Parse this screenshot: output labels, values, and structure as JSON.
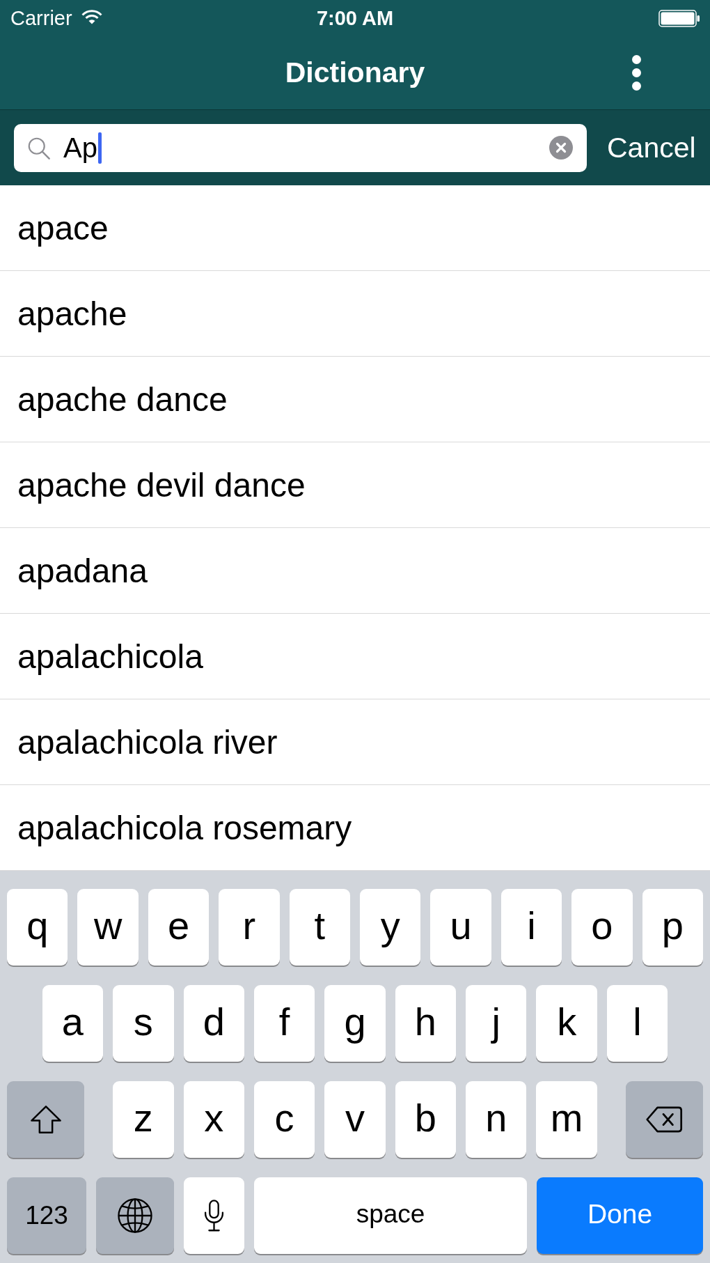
{
  "status_bar": {
    "carrier": "Carrier",
    "time": "7:00 AM"
  },
  "nav_bar": {
    "title": "Dictionary"
  },
  "search": {
    "value": "Ap",
    "cancel": "Cancel"
  },
  "results": [
    "apace",
    "apache",
    "apache dance",
    "apache devil dance",
    "apadana",
    "apalachicola",
    "apalachicola river",
    "apalachicola rosemary"
  ],
  "keyboard": {
    "rows": [
      {
        "keys": [
          {
            "kind": "letter",
            "label": "q"
          },
          {
            "kind": "letter",
            "label": "w"
          },
          {
            "kind": "letter",
            "label": "e"
          },
          {
            "kind": "letter",
            "label": "r"
          },
          {
            "kind": "letter",
            "label": "t"
          },
          {
            "kind": "letter",
            "label": "y"
          },
          {
            "kind": "letter",
            "label": "u"
          },
          {
            "kind": "letter",
            "label": "i"
          },
          {
            "kind": "letter",
            "label": "o"
          },
          {
            "kind": "letter",
            "label": "p"
          }
        ]
      },
      {
        "keys": [
          {
            "kind": "letter",
            "label": "a"
          },
          {
            "kind": "letter",
            "label": "s"
          },
          {
            "kind": "letter",
            "label": "d"
          },
          {
            "kind": "letter",
            "label": "f"
          },
          {
            "kind": "letter",
            "label": "g"
          },
          {
            "kind": "letter",
            "label": "h"
          },
          {
            "kind": "letter",
            "label": "j"
          },
          {
            "kind": "letter",
            "label": "k"
          },
          {
            "kind": "letter",
            "label": "l"
          }
        ]
      },
      {
        "keys": [
          {
            "kind": "shift"
          },
          {
            "kind": "letter",
            "label": "z"
          },
          {
            "kind": "letter",
            "label": "x"
          },
          {
            "kind": "letter",
            "label": "c"
          },
          {
            "kind": "letter",
            "label": "v"
          },
          {
            "kind": "letter",
            "label": "b"
          },
          {
            "kind": "letter",
            "label": "n"
          },
          {
            "kind": "letter",
            "label": "m"
          },
          {
            "kind": "backspace"
          }
        ]
      },
      {
        "keys": [
          {
            "kind": "numbers",
            "label": "123"
          },
          {
            "kind": "globe"
          },
          {
            "kind": "mic"
          },
          {
            "kind": "space",
            "label": "space"
          },
          {
            "kind": "done",
            "label": "Done"
          }
        ]
      }
    ]
  }
}
